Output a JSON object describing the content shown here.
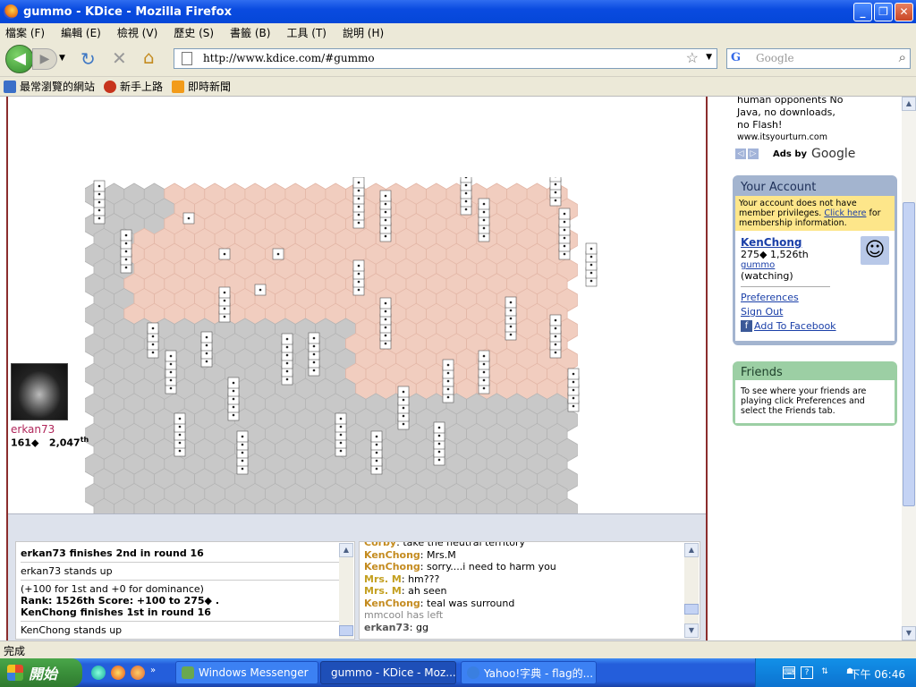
{
  "window": {
    "title": "gummo - KDice - Mozilla Firefox"
  },
  "menu": [
    "檔案 (F)",
    "編輯 (E)",
    "檢視 (V)",
    "歷史 (S)",
    "書籤 (B)",
    "工具 (T)",
    "說明 (H)"
  ],
  "nav": {
    "url": "http://www.kdice.com/#gummo",
    "search_placeholder": "Google",
    "search_engine_letter": "G"
  },
  "bookmarks": [
    "最常瀏覽的網站",
    "新手上路",
    "即時新聞"
  ],
  "game": {
    "player_name": "erkan73",
    "player_stats": "161◆",
    "player_rank": "2,047",
    "player_rank_suffix": "th"
  },
  "log": {
    "lines": [
      {
        "text": "erkan73 finishes 2nd in round 16",
        "bold": true
      },
      {
        "text": "erkan73 stands up",
        "bold": false
      },
      {
        "text": "(+100 for 1st and +0 for dominance)",
        "bold": false
      },
      {
        "text": "Rank: 1526th Score: +100 to 275◆ .",
        "bold": true
      },
      {
        "text": "KenChong finishes 1st in round 16",
        "bold": true
      },
      {
        "text": "KenChong stands up",
        "bold": false
      }
    ]
  },
  "chat": {
    "messages": [
      {
        "name": "Corby",
        "text": "take the neutral territory"
      },
      {
        "name": "KenChong",
        "text": "Mrs.M"
      },
      {
        "name": "KenChong",
        "text": "sorry....i need to harm you"
      },
      {
        "name": "Mrs. M",
        "text": "hm???"
      },
      {
        "name": "Mrs. M",
        "text": "ah seen"
      },
      {
        "name": "KenChong",
        "text": "teal was surround"
      },
      {
        "name": "",
        "text": "mmcool has left"
      },
      {
        "name": "erkan73",
        "text": "gg"
      }
    ]
  },
  "sidebar": {
    "ad_lines": [
      "human opponents No",
      "Java, no downloads,",
      "no Flash!",
      "www.itsyourturn.com"
    ],
    "ads_by": "Ads by",
    "ads_google": "Google",
    "account": {
      "header": "Your Account",
      "warn_pre": "Your account does not have member privileges.",
      "warn_link": "Click here",
      "warn_post": "for membership information.",
      "username": "KenChong",
      "stats": "275◆  1,526th",
      "room": "gummo",
      "status": "(watching)",
      "prefs": "Preferences",
      "signout": "Sign Out",
      "facebook": "Add To Facebook"
    },
    "friends": {
      "header": "Friends",
      "text": "To see where your friends are playing click Preferences and select the Friends tab."
    }
  },
  "statusbar": {
    "text": "完成"
  },
  "taskbar": {
    "start": "開始",
    "windows": [
      {
        "label": "Windows Messenger"
      },
      {
        "label": "gummo - KDice - Moz..."
      },
      {
        "label": "Yahoo!字典 - flag的..."
      }
    ],
    "clock": "下午 06:46"
  },
  "colors": {
    "player_red": "#f1cdbf",
    "neutral_grey": "#c8c8c8",
    "border_red": "#a0461e"
  }
}
